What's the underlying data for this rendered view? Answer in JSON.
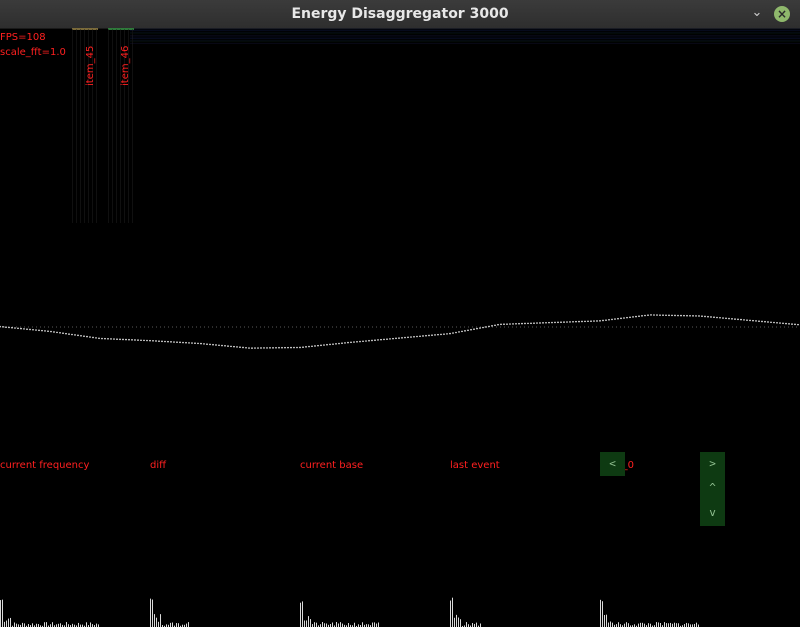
{
  "window": {
    "title": "Energy Disaggregator 3000",
    "minimize_glyph": "⌄",
    "close_glyph": "×"
  },
  "hud": {
    "fps": "FPS=108",
    "scale": "scale_fft=1.0"
  },
  "item_labels": [
    "item_45",
    "item_46"
  ],
  "panels": [
    "current frequency",
    "diff",
    "current base",
    "last event",
    "item_0"
  ],
  "nav": {
    "prev": "<",
    "next": ">",
    "up": "^",
    "down": "v"
  },
  "colors": {
    "text": "#ff2020",
    "button_bg": "#0e3a12",
    "button_fg": "#8fbf8f",
    "waveform": "#ffffff"
  },
  "chart_data": {
    "type": "line",
    "x": [
      0,
      50,
      100,
      150,
      200,
      250,
      300,
      350,
      400,
      450,
      500,
      550,
      600,
      650,
      700,
      750,
      800
    ],
    "series": [
      {
        "values": [
          0.02,
          -0.2,
          -0.52,
          -0.62,
          -0.75,
          -0.96,
          -0.93,
          -0.7,
          -0.5,
          -0.3,
          0.12,
          0.2,
          0.28,
          0.55,
          0.5,
          0.3,
          0.1
        ]
      }
    ]
  }
}
